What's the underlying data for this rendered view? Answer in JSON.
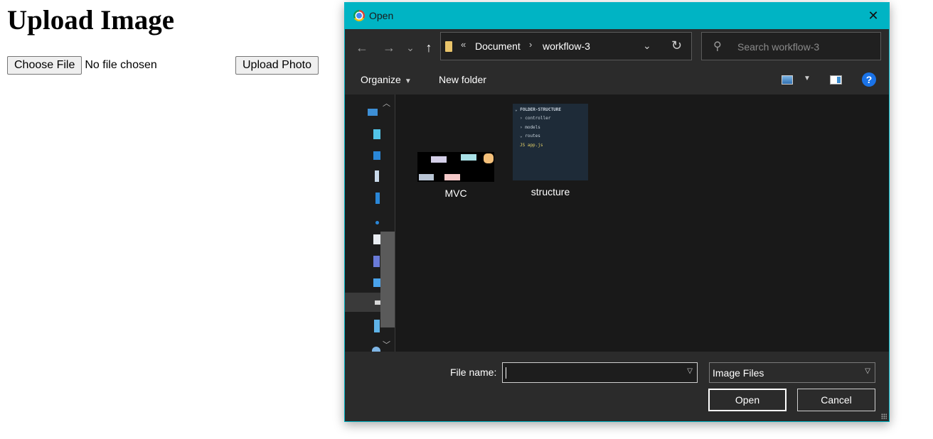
{
  "page": {
    "title": "Upload Image",
    "choose_file_label": "Choose File",
    "no_file_text": "No file chosen",
    "upload_label": "Upload Photo"
  },
  "dialog": {
    "title": "Open",
    "close_glyph": "✕",
    "nav": {
      "back": "←",
      "forward": "→",
      "recent": "⌄",
      "up": "↑"
    },
    "address": {
      "overflow": "«",
      "crumbs": [
        "Document",
        "workflow-3"
      ],
      "separator": "›",
      "dropdown": "⌄",
      "refresh": "↻"
    },
    "search": {
      "placeholder": "Search workflow-3"
    },
    "toolbar": {
      "organize_label": "Organize",
      "new_folder_label": "New folder",
      "help_glyph": "?"
    },
    "files": [
      {
        "name": "MVC",
        "thumb": {
          "labels": [
            "Route",
            "Model",
            "View",
            "Controller",
            "DB"
          ]
        }
      },
      {
        "name": "structure",
        "thumb": {
          "lines": [
            "⌄ FOLDER-STRUCTURE",
            "› controller",
            "› models",
            "⌄ routes",
            "JS app.js"
          ]
        }
      }
    ],
    "file_name": {
      "label": "File name:",
      "value": ""
    },
    "file_type": {
      "selected": "Image Files"
    },
    "buttons": {
      "open": "Open",
      "cancel": "Cancel"
    }
  },
  "colors": {
    "titlebar": "#00b4c4",
    "dialog_bg": "#1d1d1d",
    "panel_bg": "#2b2b2b",
    "accent_blue": "#1a73e8"
  }
}
